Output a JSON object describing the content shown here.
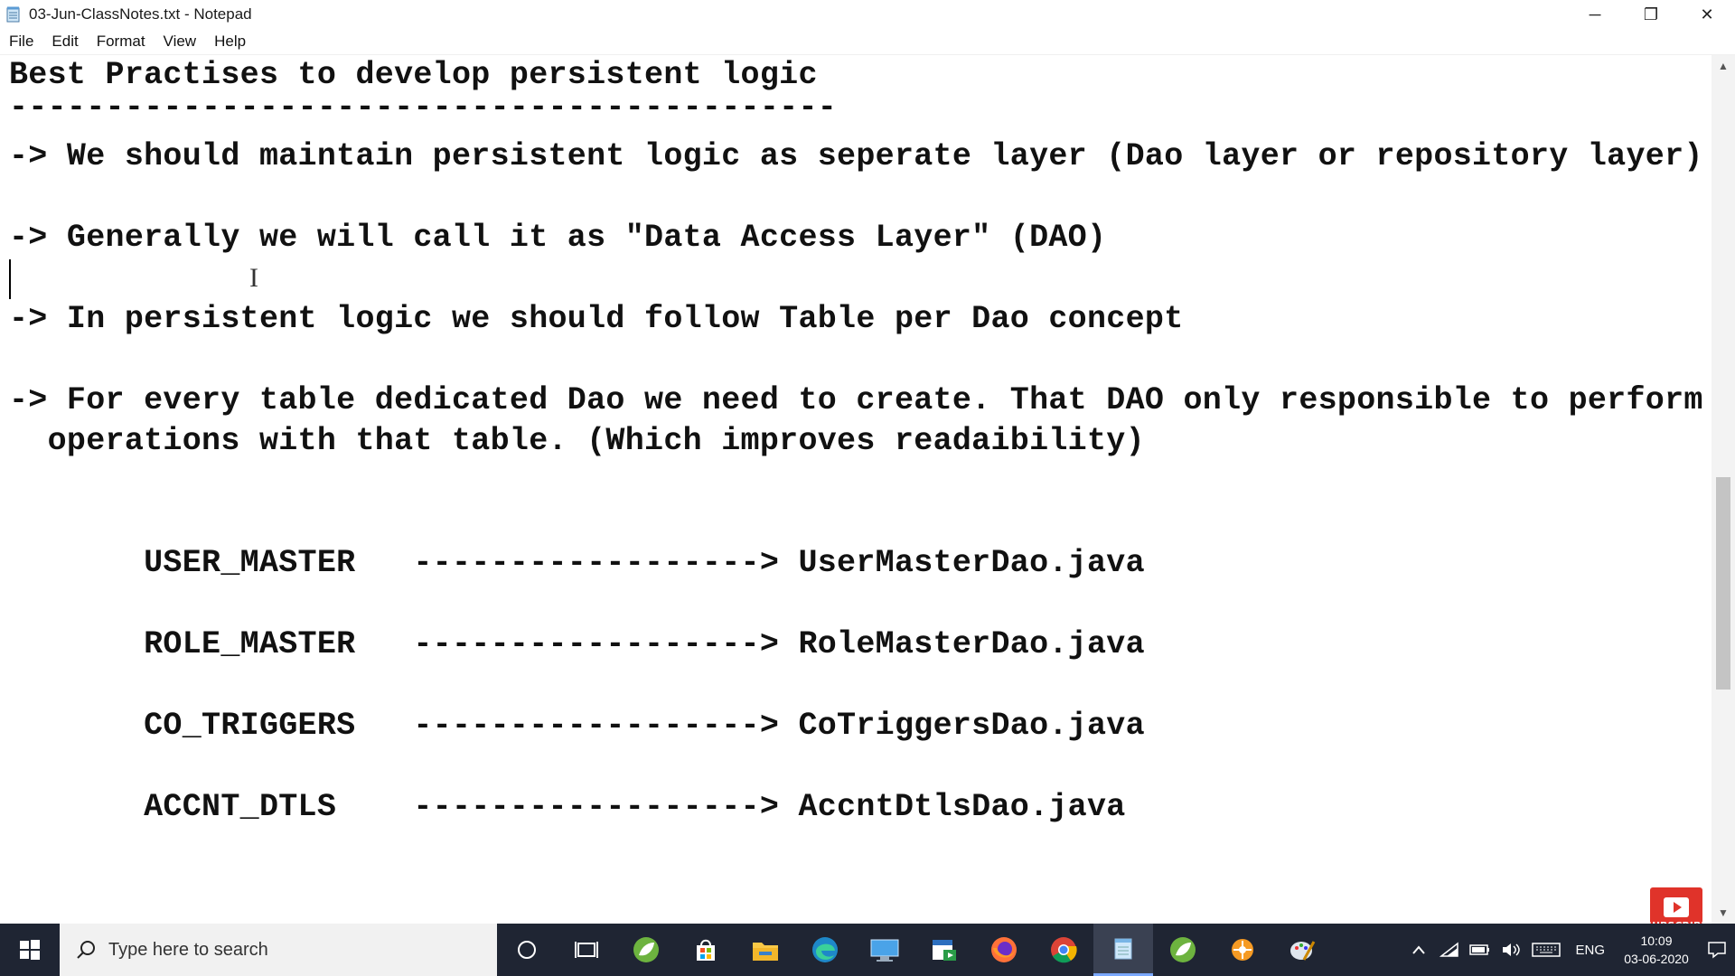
{
  "window": {
    "title": "03-Jun-ClassNotes.txt - Notepad",
    "minimize_glyph": "─",
    "restore_glyph": "❐",
    "close_glyph": "✕"
  },
  "menu": {
    "items": [
      {
        "label": "File"
      },
      {
        "label": "Edit"
      },
      {
        "label": "Format"
      },
      {
        "label": "View"
      },
      {
        "label": "Help"
      }
    ]
  },
  "editor": {
    "lines": [
      "Best Practises to develop persistent logic",
      "-------------------------------------------",
      "-> We should maintain persistent logic as seperate layer (Dao layer or repository layer)",
      "-> Generally we will call it as \"Data Access Layer\" (DAO)",
      "-> In persistent logic we should follow Table per Dao concept",
      "-> For every table dedicated Dao we need to create. That DAO only responsible to perform",
      "  operations with that table. (Which improves readaibility)",
      "       USER_MASTER   ------------------> UserMasterDao.java",
      "       ROLE_MASTER   ------------------> RoleMasterDao.java",
      "       CO_TRIGGERS   ------------------> CoTriggersDao.java",
      "       ACCNT_DTLS    ------------------> AccntDtlsDao.java"
    ]
  },
  "taskbar": {
    "search_placeholder": "Type here to search",
    "apps": [
      "cortana-icon",
      "task-view-icon",
      "spring-tool-suite-icon",
      "microsoft-store-icon",
      "file-explorer-icon",
      "edge-icon",
      "remote-desktop-icon",
      "teams-calendar-icon",
      "firefox-icon",
      "chrome-icon",
      "notepad-icon",
      "spring-tool-suite-icon-2",
      "app-orange-icon",
      "paint-icon"
    ],
    "tray": {
      "language": "ENG",
      "time": "10:09",
      "date": "03-06-2020"
    }
  },
  "overlay": {
    "subscribe_label": "SUBSCRIBE"
  }
}
